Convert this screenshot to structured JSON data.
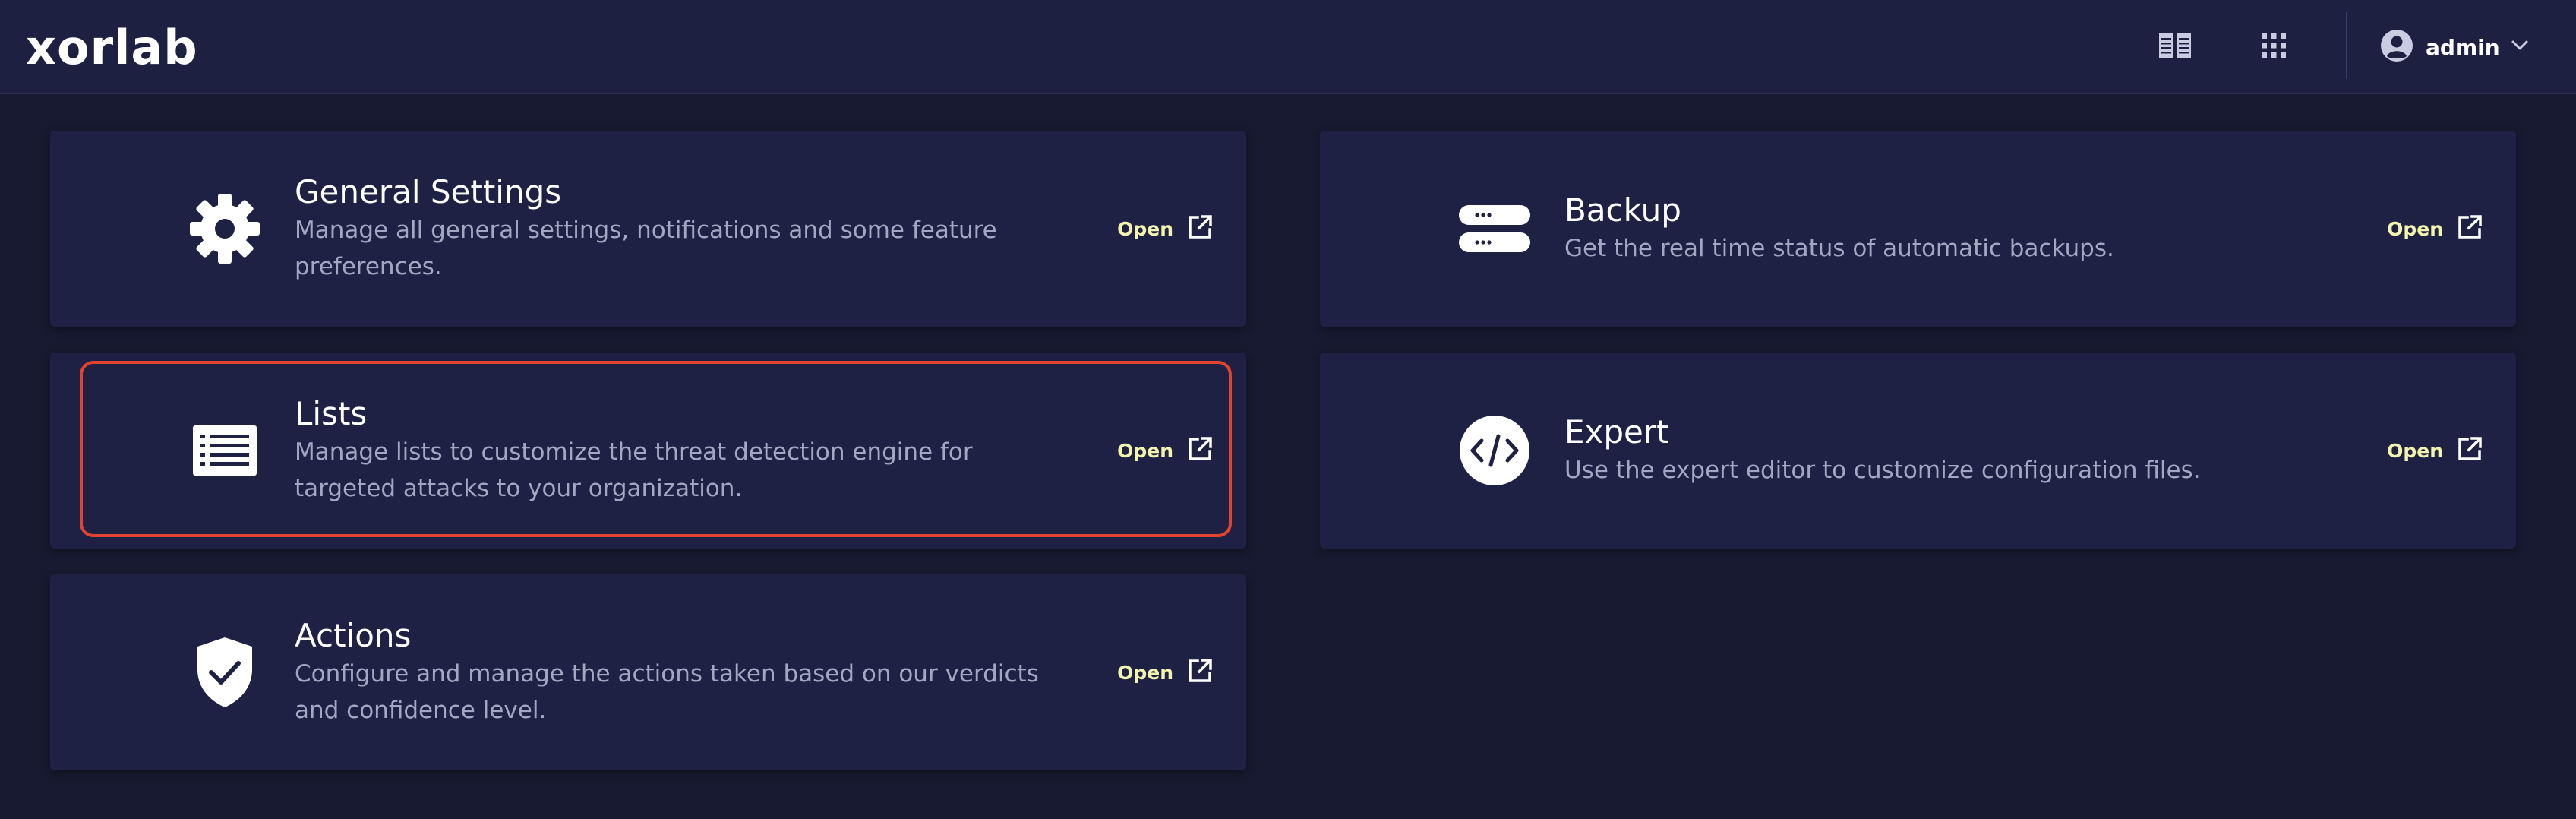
{
  "header": {
    "logo": "xorlab",
    "docs_icon": "book-open-icon",
    "apps_icon": "grid-apps-icon",
    "user_icon": "user-circle-icon",
    "user_name": "admin",
    "user_menu_icon": "chevron-down-icon"
  },
  "cards": [
    {
      "icon": "gear-icon",
      "title": "General Settings",
      "description": "Manage all general settings, notifications and some feature preferences.",
      "open_label": "Open",
      "open_icon": "external-link-icon"
    },
    {
      "icon": "list-icon",
      "title": "Lists",
      "description": "Manage lists to customize the threat detection engine for targeted attacks to your organization.",
      "open_label": "Open",
      "open_icon": "external-link-icon"
    },
    {
      "icon": "shield-check-icon",
      "title": "Actions",
      "description": "Configure and manage the actions taken based on our verdicts and confidence level.",
      "open_label": "Open",
      "open_icon": "external-link-icon"
    },
    {
      "icon": "server-icon",
      "title": "Backup",
      "description": "Get the real time status of automatic backups.",
      "open_label": "Open",
      "open_icon": "external-link-icon"
    },
    {
      "icon": "code-icon",
      "title": "Expert",
      "description": "Use the expert editor to customize configuration files.",
      "open_label": "Open",
      "open_icon": "external-link-icon"
    }
  ],
  "colors": {
    "background": "#171a30",
    "header": "#1d2040",
    "card": "#1e2143",
    "open_link": "#f3f3b0",
    "description": "#a3a7c2",
    "highlight": "#e0432f"
  }
}
